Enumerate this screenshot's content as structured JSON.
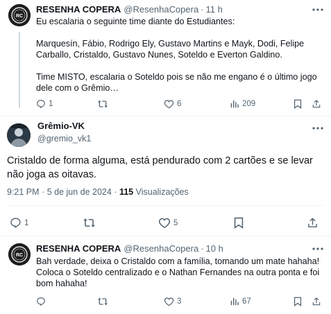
{
  "tweet1": {
    "name": "RESENHA COPERA",
    "handle": "@ResenhaCopera",
    "dot": "·",
    "time": "11 h",
    "avatar_text": "RC",
    "body": "Eu escalaria o seguinte time diante do Estudiantes:\n\nMarquesín, Fábio, Rodrigo Ely, Gustavo Martins e Mayk, Dodi, Felipe Carballo, Cristaldo, Gustavo Nunes, Soteldo e Everton Galdino.\n\nTime MISTO, escalaria o Soteldo pois se não me engano é o último jogo dele com o Grêmio…",
    "replies": "1",
    "reposts": "",
    "likes": "6",
    "views": "209"
  },
  "tweet2": {
    "name": "Grêmio-VK",
    "handle": "@gremio_vk1",
    "body": "Cristaldo de forma alguma, está pendurado com 2 cartões e se levar não joga as oitavas.",
    "time": "9:21 PM",
    "date": "5 de jun de 2024",
    "views_count": "115",
    "views_label": "Visualizações",
    "replies": "1",
    "reposts": "",
    "likes": "5"
  },
  "tweet3": {
    "name": "RESENHA COPERA",
    "handle": "@ResenhaCopera",
    "dot": "·",
    "time": "10 h",
    "avatar_text": "RC",
    "body": "Bah verdade, deixa o Cristaldo com a família, tomando um mate hahaha! Coloca o Soteldo centralizado e o Nathan Fernandes na outra ponta e foi bom hahaha!",
    "replies": "",
    "reposts": "",
    "likes": "3",
    "views": "67"
  },
  "colors": {
    "text": "#0f1419",
    "muted": "#536471",
    "line": "#cfd9de",
    "border": "#eff3f4"
  }
}
